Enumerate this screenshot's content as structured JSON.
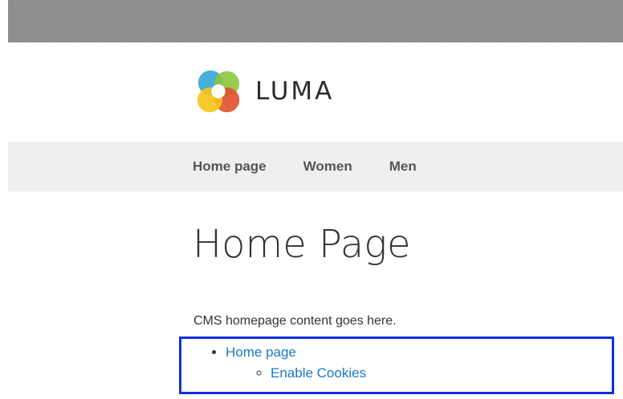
{
  "header": {
    "logo_text": "LUMA",
    "logo_icon": "luma-flower-logo"
  },
  "nav": {
    "items": [
      {
        "label": "Home page"
      },
      {
        "label": "Women"
      },
      {
        "label": "Men"
      }
    ]
  },
  "main": {
    "page_title": "Home Page",
    "content_text": "CMS homepage content goes here.",
    "links": {
      "level1": "Home page",
      "level2": "Enable Cookies"
    }
  },
  "colors": {
    "link": "#1979c3",
    "highlight_border": "#1030e0",
    "nav_background": "#efefef",
    "top_bar": "#8a8a8a"
  }
}
